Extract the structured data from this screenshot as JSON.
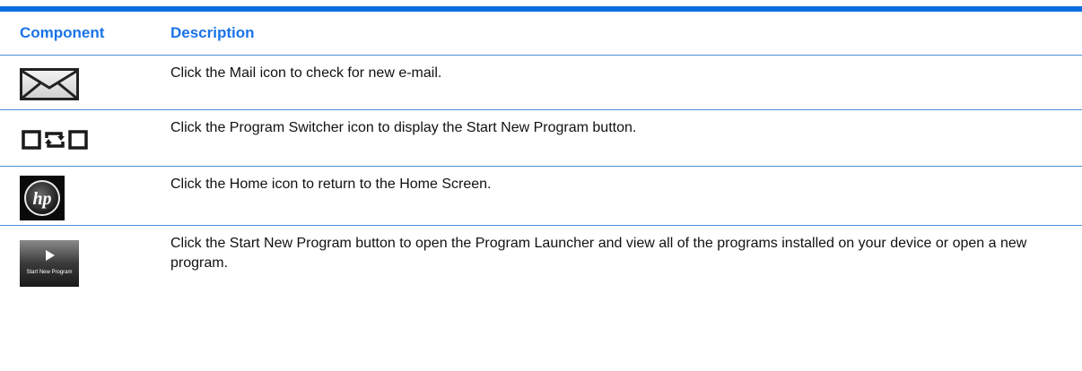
{
  "colors": {
    "accent": "#0a6ee0",
    "header_text": "#1a73e8",
    "row_rule": "#4d8fd9"
  },
  "table": {
    "headers": [
      "Component",
      "Description"
    ],
    "rows": [
      {
        "icon": "mail-icon",
        "description": "Click the Mail icon to check for new e-mail."
      },
      {
        "icon": "program-switcher-icon",
        "description": "Click the Program Switcher icon to display the Start New Program button."
      },
      {
        "icon": "hp-home-icon",
        "description": "Click the Home icon to return to the Home Screen."
      },
      {
        "icon": "start-new-program-button-icon",
        "description": "Click the Start New Program button to open the Program Launcher and view all of the programs installed on your device or open a new program.",
        "icon_caption": "Start New Program"
      }
    ]
  }
}
